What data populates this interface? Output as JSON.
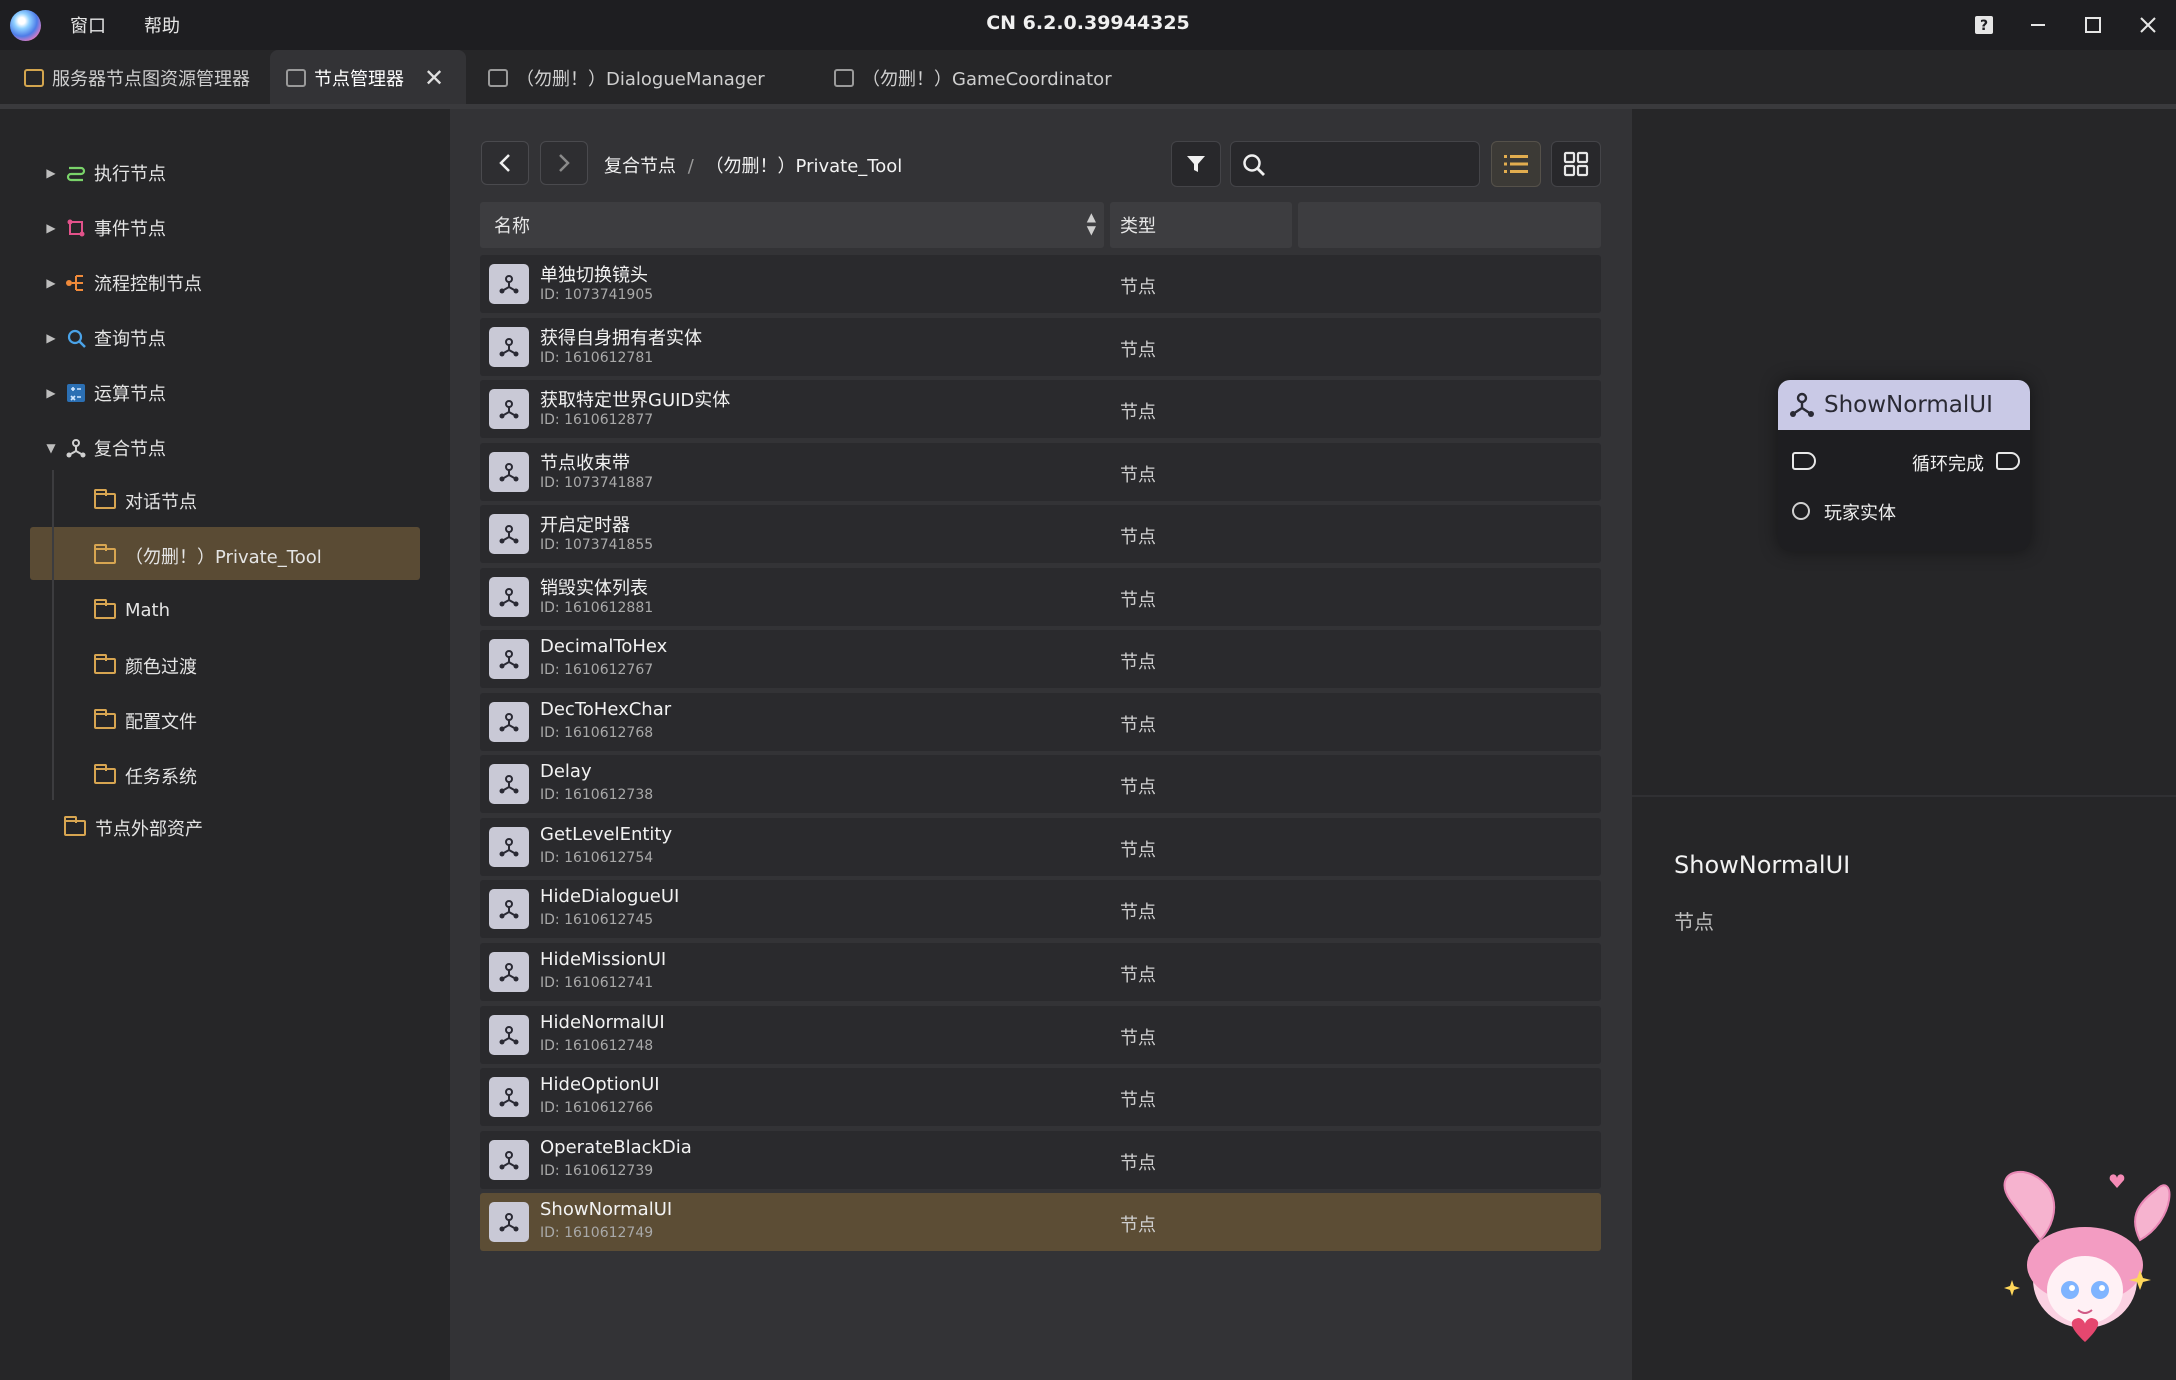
{
  "window": {
    "title": "CN 6.2.0.39944325",
    "menu": [
      "窗口",
      "帮助"
    ]
  },
  "tabs": [
    {
      "label": "服务器节点图资源管理器"
    },
    {
      "label": "节点管理器"
    },
    {
      "label": "（勿删！）DialogueManager"
    },
    {
      "label": "（勿删！）GameCoordinator"
    }
  ],
  "tree": {
    "categories": [
      "执行节点",
      "事件节点",
      "流程控制节点",
      "查询节点",
      "运算节点",
      "复合节点"
    ],
    "children": [
      "对话节点",
      "（勿删！）Private_Tool",
      "Math",
      "颜色过渡",
      "配置文件",
      "任务系统"
    ],
    "external": "节点外部资产"
  },
  "breadcrumb": [
    "复合节点",
    "/",
    "（勿删！）Private_Tool"
  ],
  "search": {
    "placeholder": "",
    "value": ""
  },
  "table": {
    "headers": {
      "name": "名称",
      "type": "类型"
    },
    "rows": [
      {
        "name": "单独切换镜头",
        "id": "ID: 1073741905",
        "type": "节点"
      },
      {
        "name": "获得自身拥有者实体",
        "id": "ID: 1610612781",
        "type": "节点"
      },
      {
        "name": "获取特定世界GUID实体",
        "id": "ID: 1610612877",
        "type": "节点"
      },
      {
        "name": "节点收束带",
        "id": "ID: 1073741887",
        "type": "节点"
      },
      {
        "name": "开启定时器",
        "id": "ID: 1073741855",
        "type": "节点"
      },
      {
        "name": "销毁实体列表",
        "id": "ID: 1610612881",
        "type": "节点"
      },
      {
        "name": "DecimalToHex",
        "id": "ID: 1610612767",
        "type": "节点"
      },
      {
        "name": "DecToHexChar",
        "id": "ID: 1610612768",
        "type": "节点"
      },
      {
        "name": "Delay",
        "id": "ID: 1610612738",
        "type": "节点"
      },
      {
        "name": "GetLevelEntity",
        "id": "ID: 1610612754",
        "type": "节点"
      },
      {
        "name": "HideDialogueUI",
        "id": "ID: 1610612745",
        "type": "节点"
      },
      {
        "name": "HideMissionUI",
        "id": "ID: 1610612741",
        "type": "节点"
      },
      {
        "name": "HideNormalUI",
        "id": "ID: 1610612748",
        "type": "节点"
      },
      {
        "name": "HideOptionUI",
        "id": "ID: 1610612766",
        "type": "节点"
      },
      {
        "name": "OperateBlackDia",
        "id": "ID: 1610612739",
        "type": "节点"
      },
      {
        "name": "ShowNormalUI",
        "id": "ID: 1610612749",
        "type": "节点"
      }
    ]
  },
  "preview": {
    "node_title": "ShowNormalUI",
    "out_exec_label": "循环完成",
    "in_data_label": "玩家实体",
    "detail_name": "ShowNormalUI",
    "detail_type": "节点"
  },
  "colors": {
    "selection": "#5c4d35",
    "tree_selection": "#5a4b34",
    "accent_gold": "#d7a551",
    "node_header": "#c9c9e6"
  }
}
